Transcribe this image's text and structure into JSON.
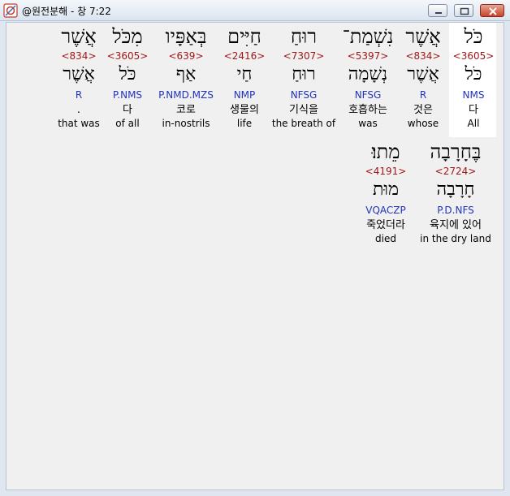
{
  "window": {
    "title": "@원전분해 - 창 7:22"
  },
  "rows": [
    {
      "words": [
        {
          "hebrew": "כֹּל",
          "strong": "<3605>",
          "lemma": "כֹּל",
          "morph": "NMS",
          "korean": "다",
          "english": "All",
          "highlighted": true
        },
        {
          "hebrew": "אֲשֶׁר",
          "strong": "<834>",
          "lemma": "אֲשֶׁר",
          "morph": "R",
          "korean": "것은",
          "english": "whose",
          "highlighted": false
        },
        {
          "hebrew": "נִשְׁמַת־",
          "strong": "<5397>",
          "lemma": "נְשָׁמָה",
          "morph": "NFSG",
          "korean": "호흡하는",
          "english": "was",
          "highlighted": false
        },
        {
          "hebrew": "רוּחַ",
          "strong": "<7307>",
          "lemma": "רוּחַ",
          "morph": "NFSG",
          "korean": "기식을",
          "english": "the breath of",
          "highlighted": false
        },
        {
          "hebrew": "חַיִּים",
          "strong": "<2416>",
          "lemma": "חַי",
          "morph": "NMP",
          "korean": "생물의",
          "english": "life",
          "highlighted": false
        },
        {
          "hebrew": "בְּאַפָּיו",
          "strong": "<639>",
          "lemma": "אַף",
          "morph": "P.NMD.MZS",
          "korean": "코로",
          "english": "in-nostrils",
          "highlighted": false
        },
        {
          "hebrew": "מִכֹּל",
          "strong": "<3605>",
          "lemma": "כֹּל",
          "morph": "P.NMS",
          "korean": "다",
          "english": "of all",
          "highlighted": false
        },
        {
          "hebrew": "אֲשֶׁר",
          "strong": "<834>",
          "lemma": "אֲשֶׁר",
          "morph": "R",
          "korean": ".",
          "english": "that was",
          "highlighted": false
        }
      ]
    },
    {
      "words": [
        {
          "hebrew": "בֶּחָרָבָה",
          "strong": "<2724>",
          "lemma": "חָרָבָה",
          "morph": "P.D.NFS",
          "korean": "육지에 있어",
          "english": "in the dry land",
          "highlighted": false
        },
        {
          "hebrew": "מֵתוּ׃",
          "strong": "<4191>",
          "lemma": "מוּת",
          "morph": "VQACZP",
          "korean": "죽었더라",
          "english": "died",
          "highlighted": false
        }
      ]
    }
  ]
}
